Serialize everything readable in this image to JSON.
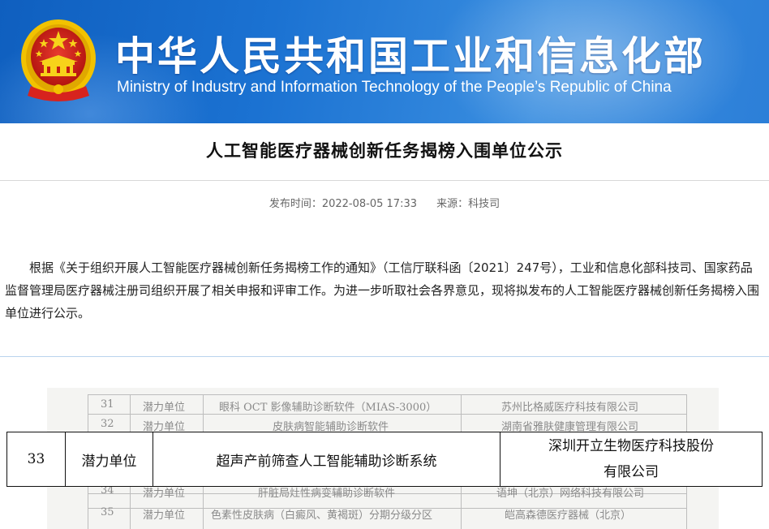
{
  "header": {
    "title_cn": "中华人民共和国工业和信息化部",
    "title_en": "Ministry of Industry and Information Technology of the People’s Republic of China",
    "emblem_icon": "national-emblem-icon",
    "colors": {
      "banner": "#1b72d2",
      "emblem_red": "#d7231e",
      "emblem_gold": "#f2c200"
    }
  },
  "article": {
    "title": "人工智能医疗器械创新任务揭榜入围单位公示",
    "publish_time": "发布时间：2022-08-05 17:33",
    "source": "来源：科技司",
    "body": "根据《关于组织开展人工智能医疗器械创新任务揭榜工作的通知》（工信厅联科函〔2021〕247号），工业和信息化部科技司、国家药品监督管理局医疗器械注册司组织开展了相关申报和评审工作。为进一步听取社会各界意见，现将拟发布的人工智能医疗器械创新任务揭榜入围单位进行公示。"
  },
  "table_scan": {
    "rows": [
      {
        "no": "31",
        "type": "潜力单位",
        "task": "眼科 OCT 影像辅助诊断软件（MIAS-3000）",
        "unit": "苏州比格威医疗科技有限公司"
      },
      {
        "no": "32",
        "type": "潜力单位",
        "task": "皮肤病智能辅助诊断软件",
        "unit": "湖南省雅肤健康管理有限公司"
      },
      {
        "no": "34",
        "type": "潜力单位",
        "task": "肝脏局灶性病变辅助诊断软件",
        "unit": "语坤（北京）网络科技有限公司"
      },
      {
        "no": "35",
        "type": "潜力单位",
        "task": "色素性皮肤病（白癜风、黄褐斑）分期分级分区",
        "unit": "皑高森德医疗器械（北京）"
      }
    ],
    "highlighted": {
      "no": "33",
      "type": "潜力单位",
      "task": "超声产前筛查人工智能辅助诊断系统",
      "unit_line1": "深圳开立生物医疗科技股份",
      "unit_line2": "有限公司"
    }
  }
}
